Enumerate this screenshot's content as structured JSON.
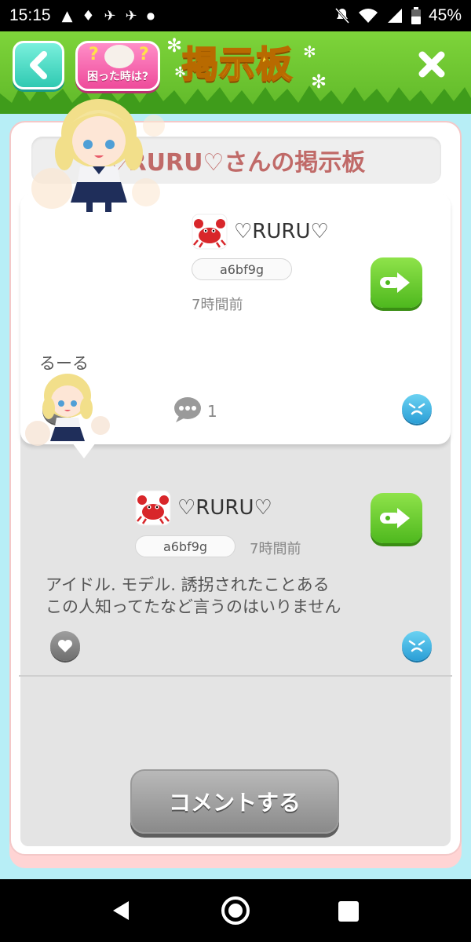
{
  "status_bar": {
    "time": "15:15",
    "battery": "45%",
    "icons": [
      "warning-icon",
      "graduation-cap-icon",
      "notification-icon",
      "notification-icon",
      "dot-icon",
      "mute-icon",
      "wifi-icon",
      "signal-icon",
      "battery-icon"
    ]
  },
  "header": {
    "title": "掲示板",
    "help_label": "困った時は?",
    "help_q": "?",
    "back_icon": "chevron-left-icon",
    "close_icon": "close-icon",
    "accent": "#6cc630"
  },
  "board": {
    "title": "♡RURU♡さんの掲示板"
  },
  "post": {
    "username": "♡RURU♡",
    "user_id": "a6bf9g",
    "time_ago": "7時間前",
    "text": "るーる",
    "comment_count": "1"
  },
  "comments": [
    {
      "username": "♡RURU♡",
      "user_id": "a6bf9g",
      "time_ago": "7時間前",
      "text_line1": "アイドル. モデル. 誘拐されたことある",
      "text_line2": "この人知ってたなど言うのはいりません"
    }
  ],
  "actions": {
    "comment_button": "コメントする"
  },
  "colors": {
    "title_text": "#c06a68",
    "green_button": "#5cc424",
    "gray_button": "#9e9e9e",
    "background": "#b7eef6"
  }
}
